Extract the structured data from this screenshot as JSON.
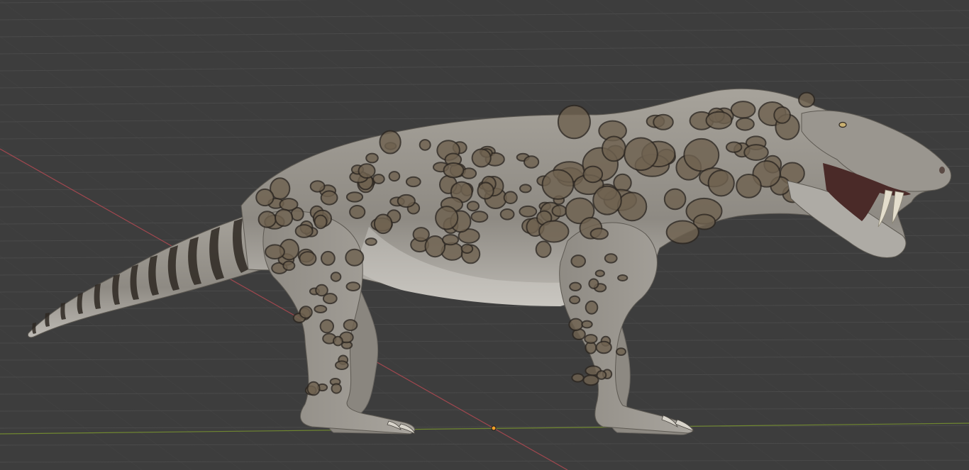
{
  "viewport": {
    "background": "#3d3d3d",
    "grid_color": "#4a4a4a",
    "x_axis_color": "#c24b55",
    "y_axis_color": "#7d9a2e",
    "origin_color": "#f5a028",
    "grid": true
  },
  "model": {
    "subject": "gorgonopsid-creature",
    "skin_base": "#9a968f",
    "belly": "#bdbab4",
    "spot_fill": "#6f6250",
    "spot_outline": "#2e2822"
  }
}
